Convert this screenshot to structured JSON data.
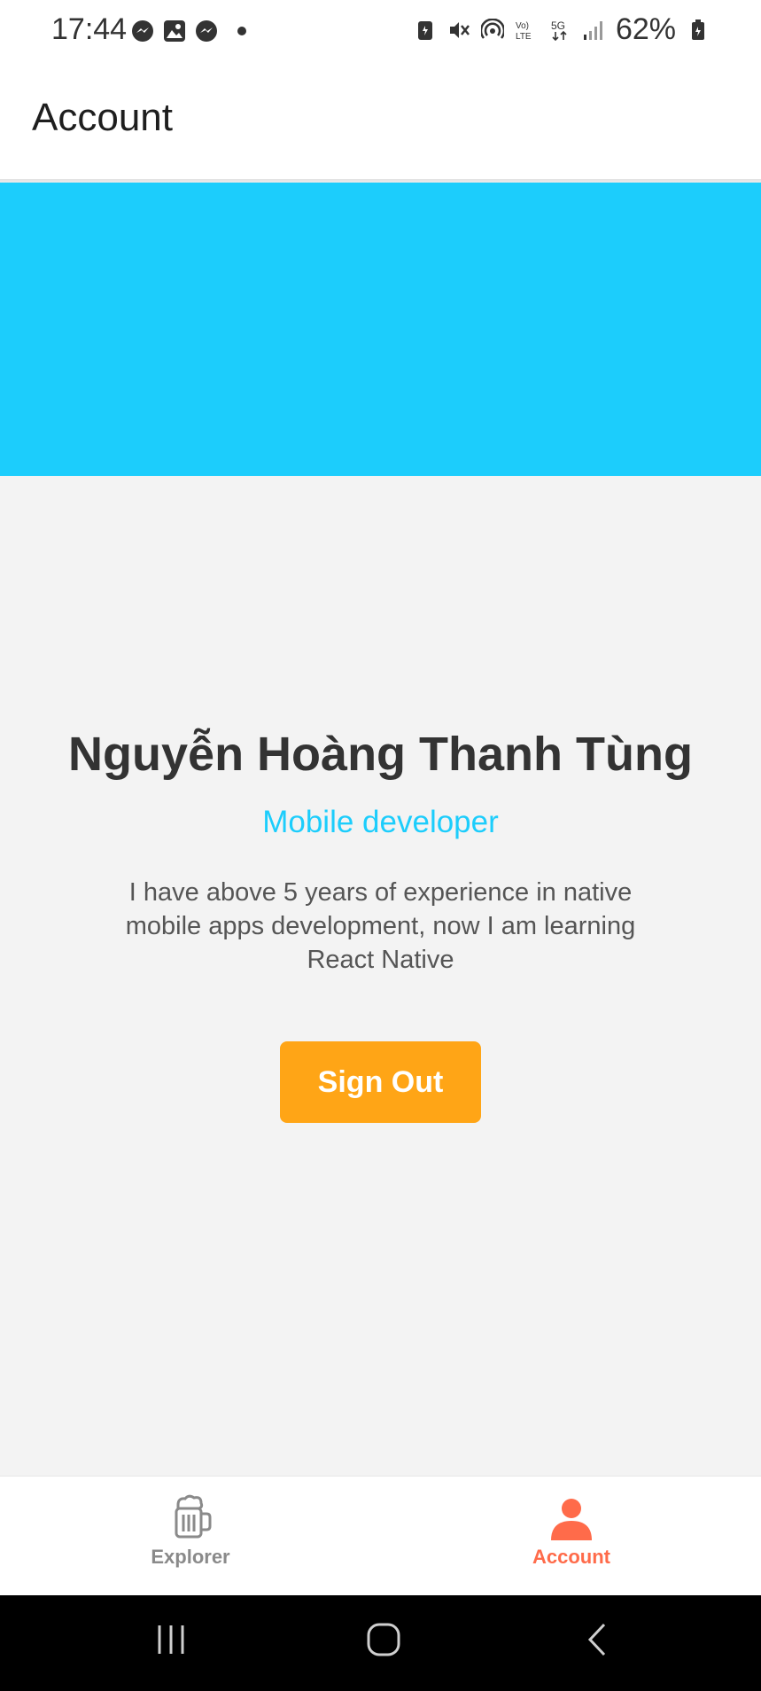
{
  "status_bar": {
    "time": "17:44",
    "battery_percent": "62%",
    "left_icons": [
      "messenger-icon",
      "gallery-icon",
      "messenger-icon",
      "notification-dot-icon"
    ],
    "right_icons": [
      "battery-saver-icon",
      "mute-vibrate-icon",
      "hotspot-icon",
      "volte-icon",
      "5g-icon",
      "signal-icon",
      "battery-icon"
    ]
  },
  "header": {
    "title": "Account"
  },
  "banner": {
    "color": "#1ccdfc"
  },
  "profile": {
    "name": "Nguyễn Hoàng Thanh Tùng",
    "role": "Mobile developer",
    "bio": "I have above 5 years of experience in native mobile apps development, now I am learning React Native"
  },
  "actions": {
    "sign_out_label": "Sign Out",
    "sign_out_color": "#ffa516"
  },
  "tab_bar": {
    "tabs": [
      {
        "label": "Explorer",
        "icon": "beer-mug-icon",
        "active": false
      },
      {
        "label": "Account",
        "icon": "user-icon",
        "active": true
      }
    ],
    "active_color": "#ff6b4a",
    "inactive_color": "#8a8a8a"
  },
  "nav_bar": {
    "buttons": [
      "recent-apps-icon",
      "home-icon",
      "back-icon"
    ]
  }
}
